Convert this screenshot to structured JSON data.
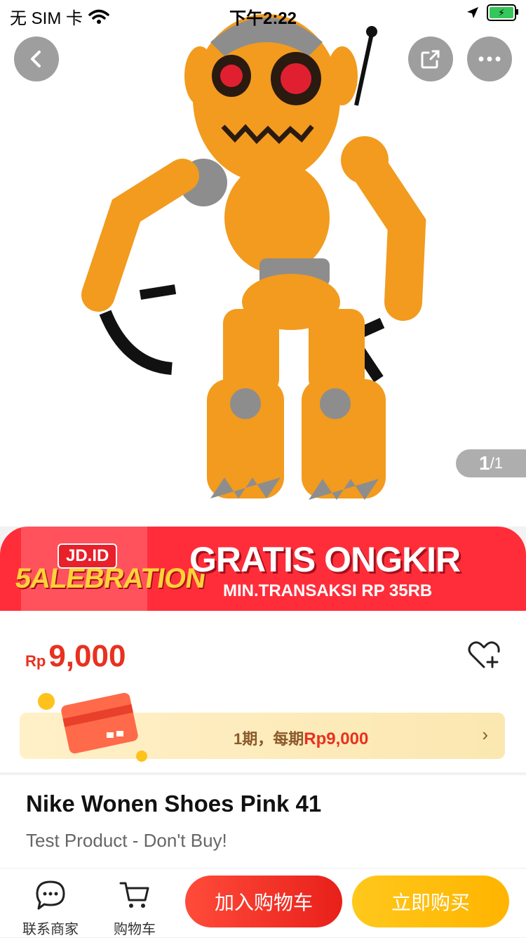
{
  "status_bar": {
    "carrier": "无 SIM 卡",
    "time": "下午2:22"
  },
  "product_image": {
    "pager_current": "1",
    "pager_total": "/1"
  },
  "promo": {
    "brand_badge": "JD.ID",
    "brand_text": "5ALEBRATION",
    "title": "GRATIS ONGKIR",
    "subtitle": "MIN.TRANSAKSI RP 35RB"
  },
  "price": {
    "currency": "Rp",
    "value": "9,000"
  },
  "installment": {
    "prefix": "1期，每期",
    "amount": "Rp9,000",
    "chevron": "›"
  },
  "product": {
    "name": "Nike Wonen Shoes Pink 41",
    "subtitle": "Test Product - Don't Buy!"
  },
  "bottom_bar": {
    "contact_label": "联系商家",
    "cart_label": "购物车",
    "add_to_cart": "加入购物车",
    "buy_now": "立即购买"
  },
  "colors": {
    "price_red": "#e8311f",
    "promo_red": "#ff2d3a",
    "cart_btn": "#ff3b2f",
    "buy_btn": "#ffbb10"
  }
}
